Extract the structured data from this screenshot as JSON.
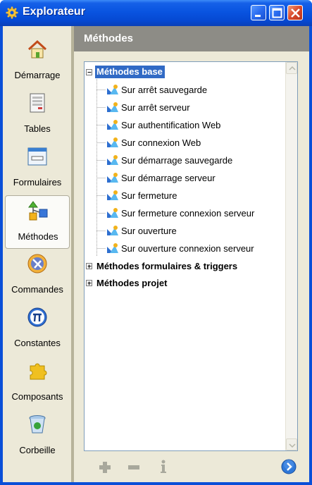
{
  "window": {
    "title": "Explorateur"
  },
  "sidebar": {
    "items": [
      {
        "label": "Démarrage",
        "icon": "home-icon"
      },
      {
        "label": "Tables",
        "icon": "tables-icon"
      },
      {
        "label": "Formulaires",
        "icon": "forms-icon"
      },
      {
        "label": "Méthodes",
        "icon": "methods-icon",
        "active": true
      },
      {
        "label": "Commandes",
        "icon": "commands-icon"
      },
      {
        "label": "Constantes",
        "icon": "pi-icon"
      },
      {
        "label": "Composants",
        "icon": "puzzle-icon"
      },
      {
        "label": "Corbeille",
        "icon": "trash-icon"
      }
    ]
  },
  "panel": {
    "title": "Méthodes",
    "tree": {
      "groups": [
        {
          "label": "Méthodes base",
          "expanded": true,
          "children": [
            "Sur arrêt sauvegarde",
            "Sur arrêt serveur",
            "Sur authentification Web",
            "Sur connexion Web",
            "Sur démarrage sauvegarde",
            "Sur démarrage serveur",
            "Sur fermeture",
            "Sur fermeture connexion serveur",
            "Sur ouverture",
            "Sur ouverture connexion serveur"
          ]
        },
        {
          "label": "Méthodes formulaires & triggers",
          "expanded": false
        },
        {
          "label": "Méthodes projet",
          "expanded": false
        }
      ]
    }
  },
  "toolbar": {
    "add_icon": "plus-icon",
    "remove_icon": "minus-icon",
    "info_icon": "info-icon",
    "go_icon": "arrow-right-icon"
  },
  "colors": {
    "titlebar": "#0954e0",
    "selection": "#316ac5",
    "panel_header": "#8d8c86",
    "background": "#ece9d8"
  }
}
